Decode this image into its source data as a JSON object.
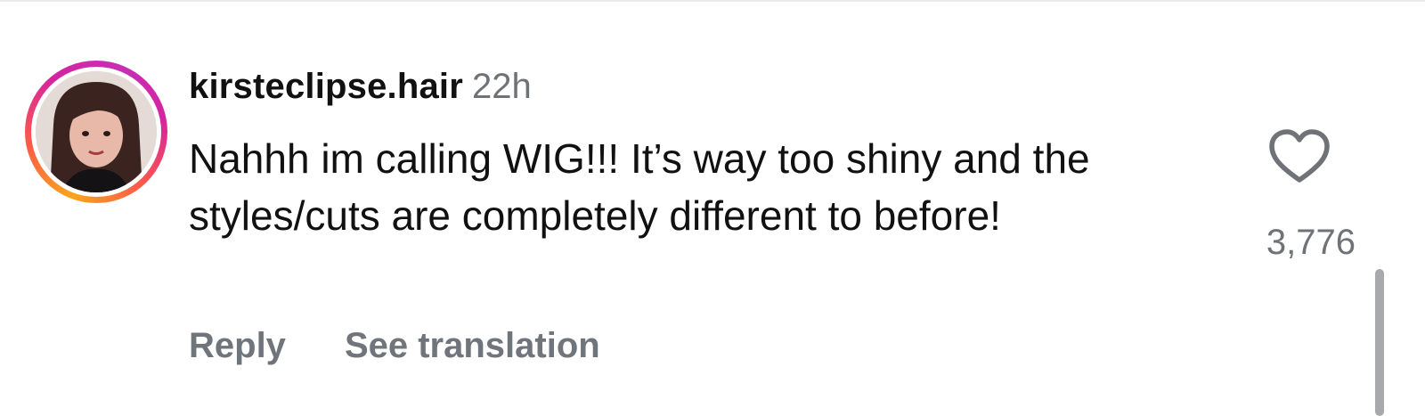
{
  "comment": {
    "username": "kirsteclipse.hair",
    "timestamp": "22h",
    "text": "Nahhh im calling WIG!!! It’s way too shiny and the styles/cuts are completely different to before!",
    "like_count": "3,776"
  },
  "actions": {
    "reply_label": "Reply",
    "translate_label": "See translation"
  },
  "icons": {
    "like": "heart-outline-icon",
    "avatar_ring": "story-ring"
  },
  "colors": {
    "text_primary": "#111111",
    "text_secondary": "#6f7378",
    "ring_gradient": [
      "#f9a51b",
      "#fd5949",
      "#d6249f"
    ]
  }
}
